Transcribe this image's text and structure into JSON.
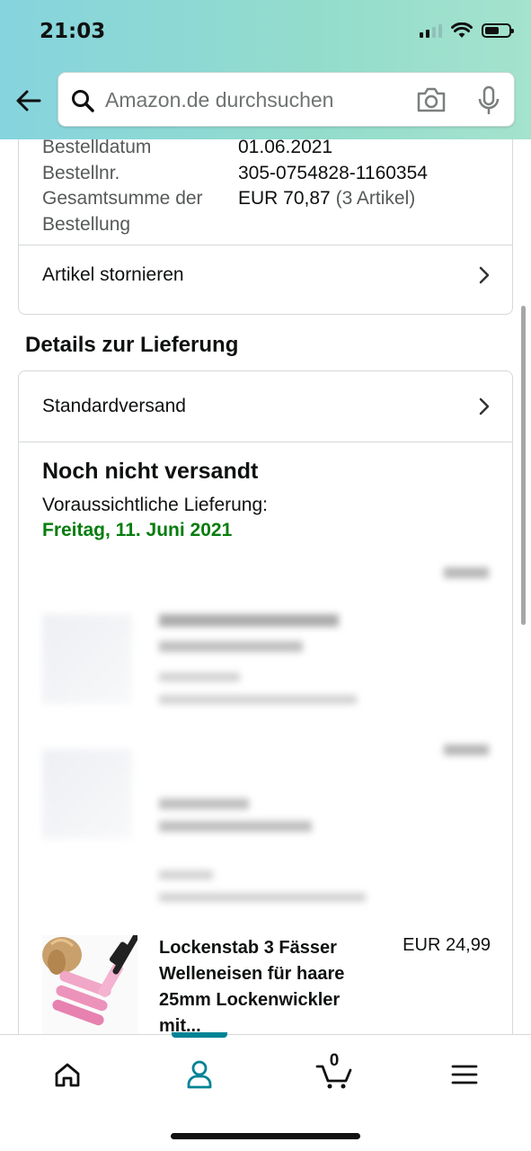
{
  "status_bar": {
    "time": "21:03"
  },
  "search": {
    "placeholder": "Amazon.de durchsuchen"
  },
  "order_info": {
    "date_label": "Bestelldatum",
    "date_value": "01.06.2021",
    "number_label": "Bestellnr.",
    "number_value": "305-0754828-1160354",
    "total_label_line1": "Gesamtsumme der",
    "total_label_line2": "Bestellung",
    "total_value": "EUR 70,87",
    "total_items": "(3 Artikel)"
  },
  "cancel_link": {
    "label": "Artikel stornieren"
  },
  "delivery": {
    "section_title": "Details zur Lieferung",
    "shipping_method": "Standardversand",
    "status_title": "Noch nicht versandt",
    "expected_label": "Voraussichtliche Lieferung:",
    "expected_date": "Freitag, 11. Juni 2021"
  },
  "products": [
    {
      "title": "Lockenstab 3 Fässer Welleneisen für haare 25mm Lockenwickler mit...",
      "price": "EUR 24,99"
    }
  ],
  "bottom_nav": {
    "cart_count": "0"
  },
  "colors": {
    "header_gradient_start": "#86d4de",
    "header_gradient_end": "#a4e3cd",
    "delivery_green": "#067d0e",
    "accent_teal": "#008296"
  }
}
